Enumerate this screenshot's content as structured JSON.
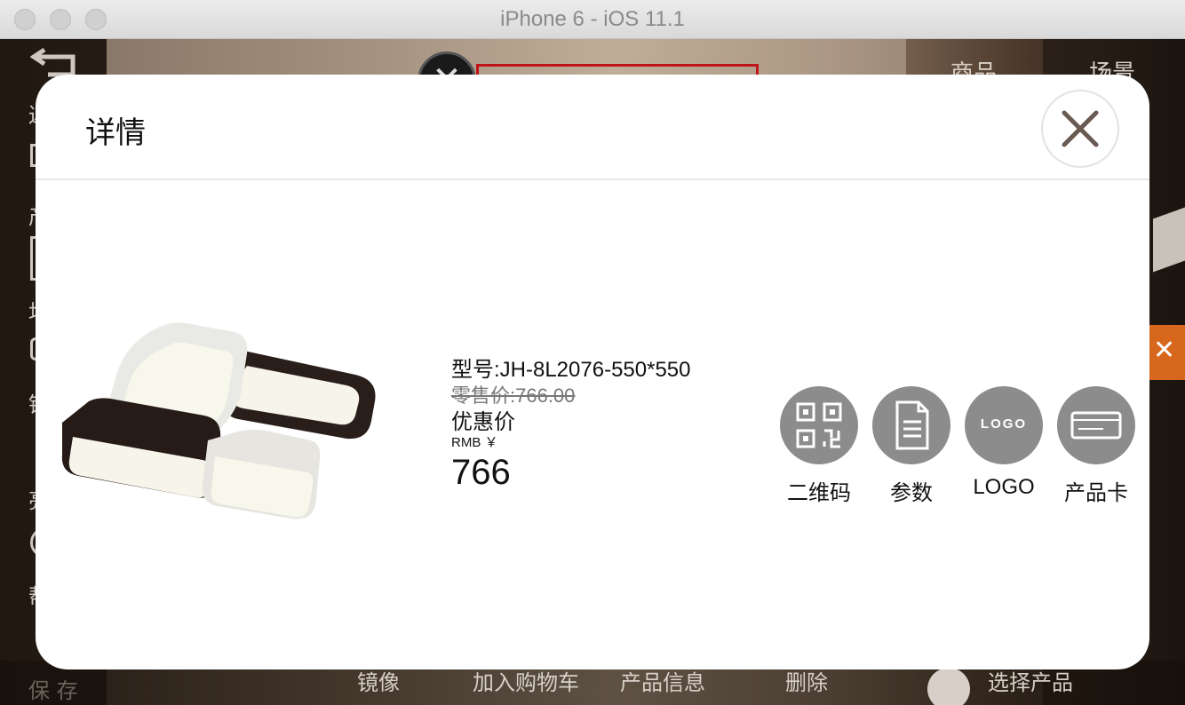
{
  "window": {
    "title": "iPhone 6 - iOS 11.1"
  },
  "background_app": {
    "tabs": [
      "商品",
      "场景"
    ],
    "left_labels": [
      "返",
      "产",
      "场",
      "镜",
      "亮",
      "帮"
    ],
    "save_label": "保 存",
    "bottom_actions": [
      "镜像",
      "加入购物车",
      "产品信息",
      "删除"
    ],
    "select_product_label": "选择产品",
    "close_mark": "✕"
  },
  "modal": {
    "title": "详情",
    "product": {
      "model": "型号:JH-8L2076-550*550",
      "retail_price": "零售价:766.00",
      "discount_label": "优惠价",
      "currency": "RMB ￥",
      "price": "766"
    },
    "actions": [
      {
        "label": "二维码",
        "icon": "qr-code-icon"
      },
      {
        "label": "参数",
        "icon": "document-icon"
      },
      {
        "label": "LOGO",
        "icon": "logo-icon"
      },
      {
        "label": "产品卡",
        "icon": "card-icon"
      }
    ],
    "logo_icon_text": "LOGO"
  },
  "colors": {
    "modal_background": "#ffffff",
    "action_circle": "#8c8c8c",
    "accent_orange": "#d8671e",
    "highlight_red": "#c0141a"
  }
}
